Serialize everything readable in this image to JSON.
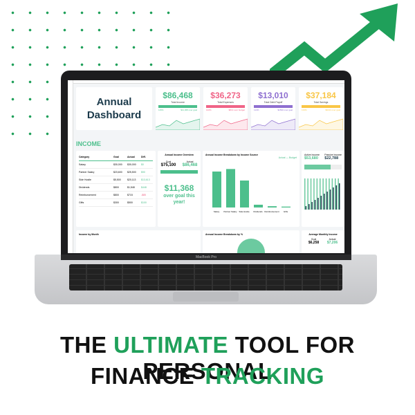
{
  "headline": {
    "line1_a": "THE ",
    "line1_b": "ULTIMATE",
    "line1_c": " TOOL FOR PERSONAL",
    "line2_a": "FINANCE ",
    "line2_b": "TRACKING"
  },
  "laptop_label": "MacBook Pro",
  "dashboard": {
    "title_line1": "Annual",
    "title_line2": "Dashboard",
    "kpis": [
      {
        "value": "$86,468",
        "label": "Total Income",
        "pct": "115%",
        "note": "$11,368 over goal",
        "color": "#4cbf8c"
      },
      {
        "value": "$36,273",
        "label": "Total Expenses",
        "pct": "102%",
        "note": "$813 over budget",
        "color": "#f06487"
      },
      {
        "value": "$13,010",
        "label": "Total Debt Payoff",
        "pct": "114%",
        "note": "$1590 over goal",
        "color": "#8e6fd0"
      },
      {
        "value": "$37,184",
        "label": "Total Savings",
        "pct": "133%",
        "note": "$9134 over goal",
        "color": "#f9c646"
      }
    ],
    "income_section": "INCOME",
    "table": {
      "headers": [
        "Category",
        "Goal",
        "Actual",
        "Diff."
      ],
      "rows": [
        [
          "Salary",
          "$30,000",
          "$30,000",
          "$0"
        ],
        [
          "Partner Salary",
          "$23,600",
          "$25,500",
          "$90"
        ],
        [
          "Side Hustle",
          "$5,500",
          "$20,113",
          "$13,613"
        ],
        [
          "Dividends",
          "$800",
          "$1,548",
          "$448"
        ],
        [
          "Reimbursement",
          "$800",
          "$715",
          "-$85"
        ],
        [
          "Gifts",
          "$300",
          "$500",
          "$100"
        ]
      ]
    },
    "overview": {
      "title": "Annual Income Overview",
      "goal_label": "Goal",
      "goal": "$75,100",
      "actual_label": "Actual",
      "actual": "$86,468",
      "big": "$11,368",
      "msg": "over goal this year!"
    },
    "breakdown": {
      "title": "Annual Income Breakdown by Income Source",
      "legend_actual": "Actual",
      "legend_budget": "Budget",
      "categories": [
        "Salary",
        "Partner Salary",
        "Side Hustle",
        "Dividends",
        "Reimbursement",
        "Gifts"
      ],
      "values": [
        20000,
        21400,
        15000,
        1548,
        715,
        500
      ]
    },
    "active_income": {
      "label": "Active Income",
      "value": "$53,680"
    },
    "passive_income": {
      "label": "Passive Income",
      "value": "$22,788"
    },
    "income_by_month": "Income by Month",
    "pct_breakdown": "Annual Income Breakdown by %",
    "avg_monthly": {
      "title": "Average Monthly Income",
      "goal_label": "Goal",
      "goal": "$6,258",
      "actual_label": "Actual",
      "actual": "$7,206"
    }
  }
}
